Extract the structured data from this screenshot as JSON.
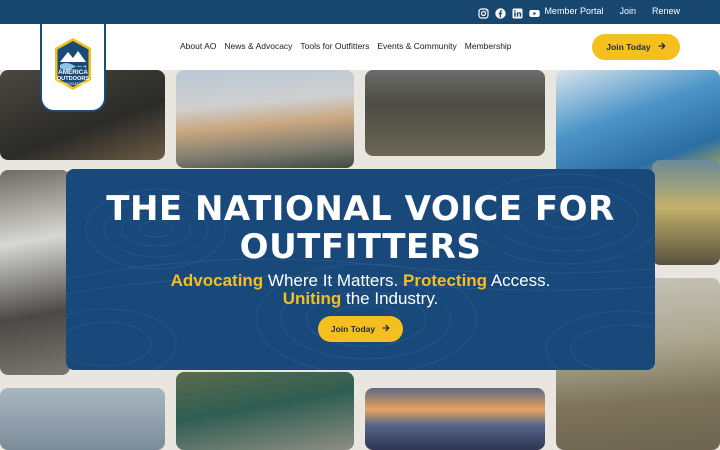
{
  "topbar": {
    "social_icons": [
      "instagram-icon",
      "facebook-icon",
      "linkedin-icon",
      "youtube-icon"
    ],
    "links": [
      {
        "label": "Member Portal"
      },
      {
        "label": "Join"
      },
      {
        "label": "Renew"
      }
    ]
  },
  "logo": {
    "text": "AMERICA OUTDOORS ASSOCIATION"
  },
  "nav": {
    "items": [
      {
        "label": "About AO"
      },
      {
        "label": "News & Advocacy"
      },
      {
        "label": "Tools for Outfitters"
      },
      {
        "label": "Events & Community"
      },
      {
        "label": "Membership"
      }
    ],
    "join_label": "Join Today"
  },
  "hero": {
    "title_line1": "THE NATIONAL VOICE FOR",
    "title_line2": "OUTFITTERS",
    "tag": {
      "a": "Advocating",
      "a_rest": " Where It Matters. ",
      "b": "Protecting",
      "b_rest": " Access.",
      "c": "Uniting",
      "c_rest": " the Industry."
    },
    "join_label": "Join Today"
  },
  "colors": {
    "brand_blue": "#17466f",
    "accent_yellow": "#f5bf1e"
  }
}
